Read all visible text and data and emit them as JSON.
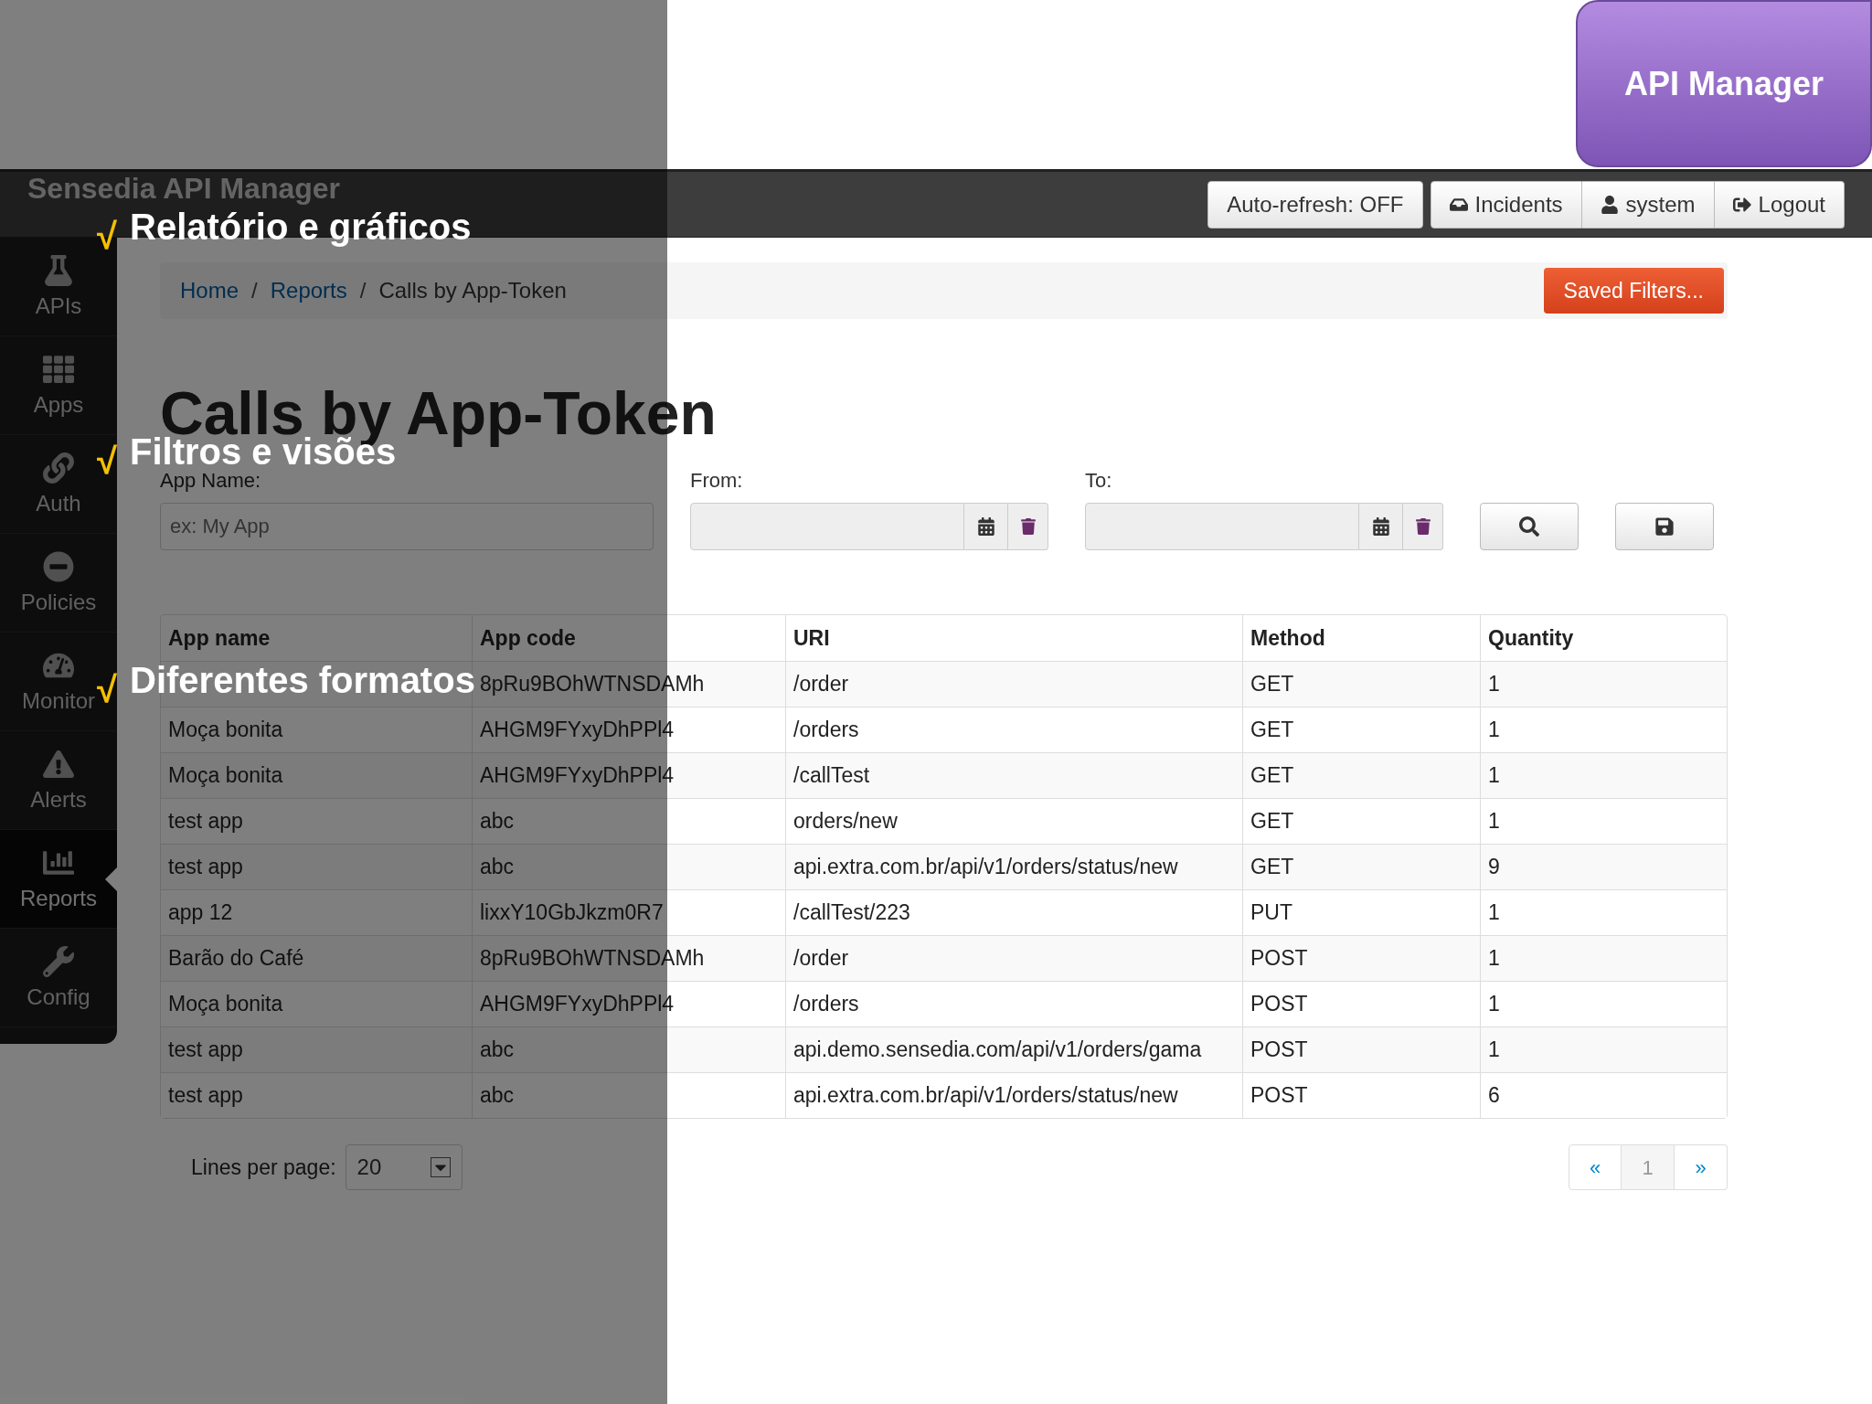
{
  "slide": {
    "badge": "API Manager",
    "bullets": [
      {
        "mark": "√",
        "text": "Relatório e gráficos"
      },
      {
        "mark": "√",
        "text": "Filtros e visões"
      },
      {
        "mark": "√",
        "text": "Diferentes formatos"
      }
    ]
  },
  "navbar": {
    "brand": "Sensedia API Manager",
    "auto_refresh": "Auto-refresh: OFF",
    "menu": [
      {
        "kind": "inbox",
        "label": "Incidents"
      },
      {
        "kind": "user",
        "label": "system"
      },
      {
        "kind": "logout",
        "label": "Logout"
      }
    ]
  },
  "sidebar": {
    "items": [
      {
        "kind": "flask",
        "label": "APIs",
        "selected": false
      },
      {
        "kind": "grid",
        "label": "Apps",
        "selected": false
      },
      {
        "kind": "link",
        "label": "Auth",
        "selected": false
      },
      {
        "kind": "minus",
        "label": "Policies",
        "selected": false
      },
      {
        "kind": "gauge",
        "label": "Monitor",
        "selected": false
      },
      {
        "kind": "alert",
        "label": "Alerts",
        "selected": false
      },
      {
        "kind": "chart",
        "label": "Reports",
        "selected": true
      },
      {
        "kind": "wrench",
        "label": "Config",
        "selected": false
      }
    ]
  },
  "breadcrumb": [
    {
      "label": "Home",
      "separator": "/",
      "current": false
    },
    {
      "label": "Reports",
      "separator": "/",
      "current": false
    },
    {
      "label": "Calls by App-Token",
      "current": true
    }
  ],
  "saved_filters": "Saved Filters...",
  "title": "Calls by App-Token",
  "filters": {
    "app_name": {
      "label": "App Name:",
      "placeholder": "ex: My App"
    },
    "from": {
      "label": "From:"
    },
    "to": {
      "label": "To:"
    }
  },
  "table": {
    "columns": [
      "App name",
      "App code",
      "URI",
      "Method",
      "Quantity"
    ],
    "rows": [
      {
        "cells": [
          null,
          "8pRu9BOhWTNSDAMh",
          "/order",
          "GET",
          "1"
        ]
      },
      {
        "cells": [
          "Moça bonita",
          "AHGM9FYxyDhPPl4",
          "/orders",
          "GET",
          "1"
        ]
      },
      {
        "cells": [
          "Moça bonita",
          "AHGM9FYxyDhPPl4",
          "/callTest",
          "GET",
          "1"
        ]
      },
      {
        "cells": [
          "test app",
          "abc",
          "orders/new",
          "GET",
          "1"
        ]
      },
      {
        "cells": [
          "test app",
          "abc",
          "api.extra.com.br/api/v1/orders/status/new",
          "GET",
          "9"
        ]
      },
      {
        "cells": [
          "app 12",
          "lixxY10GbJkzm0R7",
          "/callTest/223",
          "PUT",
          "1"
        ]
      },
      {
        "cells": [
          "Barão do Café",
          "8pRu9BOhWTNSDAMh",
          "/order",
          "POST",
          "1"
        ]
      },
      {
        "cells": [
          "Moça bonita",
          "AHGM9FYxyDhPPl4",
          "/orders",
          "POST",
          "1"
        ]
      },
      {
        "cells": [
          "test app",
          "abc",
          "api.demo.sensedia.com/api/v1/orders/gama",
          "POST",
          "1"
        ]
      },
      {
        "cells": [
          "test app",
          "abc",
          "api.extra.com.br/api/v1/orders/status/new",
          "POST",
          "6"
        ]
      }
    ]
  },
  "lines_per_page": {
    "label": "Lines per page:",
    "value": "20"
  },
  "pagination": [
    {
      "label": "«",
      "selected": false
    },
    {
      "label": "1",
      "selected": true
    },
    {
      "label": "»",
      "selected": false
    }
  ]
}
